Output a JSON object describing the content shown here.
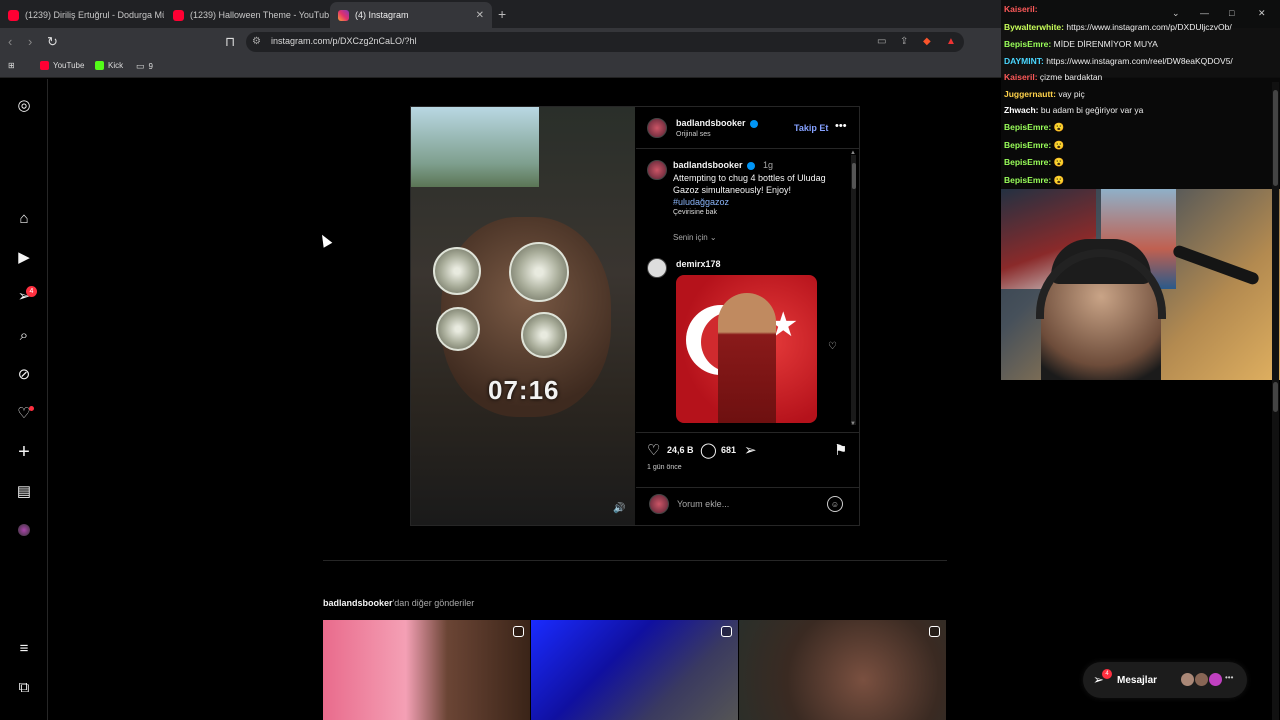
{
  "browser": {
    "tabs": [
      {
        "title": "(1239) Diriliş Ertuğrul - Dodurga Mü:",
        "favicon": "youtube"
      },
      {
        "title": "(1239) Halloween Theme - YouTube",
        "favicon": "youtube"
      },
      {
        "title": "(4) Instagram",
        "favicon": "instagram"
      }
    ],
    "url": "instagram.com/p/DXCzg2nCaLO/?hl",
    "bookmarks": [
      {
        "label": "YouTube",
        "color": "#ff0033"
      },
      {
        "label": "Kick",
        "color": "#53fc18"
      },
      {
        "label": "9",
        "color": "#999999"
      }
    ]
  },
  "sidebar": {
    "badge_count": "4",
    "icons": [
      "instagram-logo-icon",
      "home-icon",
      "reels-icon",
      "messages-icon",
      "search-icon",
      "explore-icon",
      "notifications-icon",
      "create-icon",
      "dashboard-icon",
      "profile-icon",
      "menu-icon",
      "threads-icon"
    ]
  },
  "post": {
    "author": "badlandsbooker",
    "audio": "Orijinal ses",
    "follow_label": "Takip Et",
    "timer": "07:16",
    "caption_author": "badlandsbooker",
    "caption_age": "1g",
    "caption_text": "Attempting to chug 4 bottles of Uludag Gazoz simultaneously! Enjoy!",
    "hashtag": "#uludağgazoz",
    "translate": "Çevirisine bak",
    "for_you": "Senin için ⌄",
    "commenter": "demirx178",
    "likes": "24,6 B",
    "comments": "681",
    "time_ago": "1 gün önce",
    "comment_placeholder": "Yorum ekle..."
  },
  "more_posts": {
    "author": "badlandsbooker",
    "suffix": "'dan diğer gönderiler"
  },
  "chat": [
    {
      "user": "Kaiseril:",
      "text": "",
      "color": "#ff5a5a"
    },
    {
      "user": "Bywalterwhite:",
      "text": "https://www.instagram.com/p/DXDUljczvOb/",
      "color": "#c8ff5a"
    },
    {
      "user": "BepisEmre:",
      "text": "MİDE DİRENMİYOR MUYA",
      "color": "#9aff5a"
    },
    {
      "user": "DAYMINT:",
      "text": "https://www.instagram.com/reel/DW8eaKQDOV5/",
      "color": "#4ad7ff"
    },
    {
      "user": "Kaiseril:",
      "text": "çizme bardaktan",
      "color": "#ff5a5a"
    },
    {
      "user": "Juggernautt:",
      "text": "vay piç",
      "color": "#ffd24a"
    },
    {
      "user": "Zhwach:",
      "text": "bu adam bi geğiriyor var ya",
      "color": "#ffffff"
    },
    {
      "user": "BepisEmre:",
      "text": "😮",
      "color": "#9aff5a"
    },
    {
      "user": "BepisEmre:",
      "text": "😮",
      "color": "#9aff5a"
    },
    {
      "user": "BepisEmre:",
      "text": "😮",
      "color": "#9aff5a"
    },
    {
      "user": "BepisEmre:",
      "text": "😮",
      "color": "#9aff5a"
    }
  ],
  "messages": {
    "label": "Mesajlar",
    "badge": "4"
  }
}
